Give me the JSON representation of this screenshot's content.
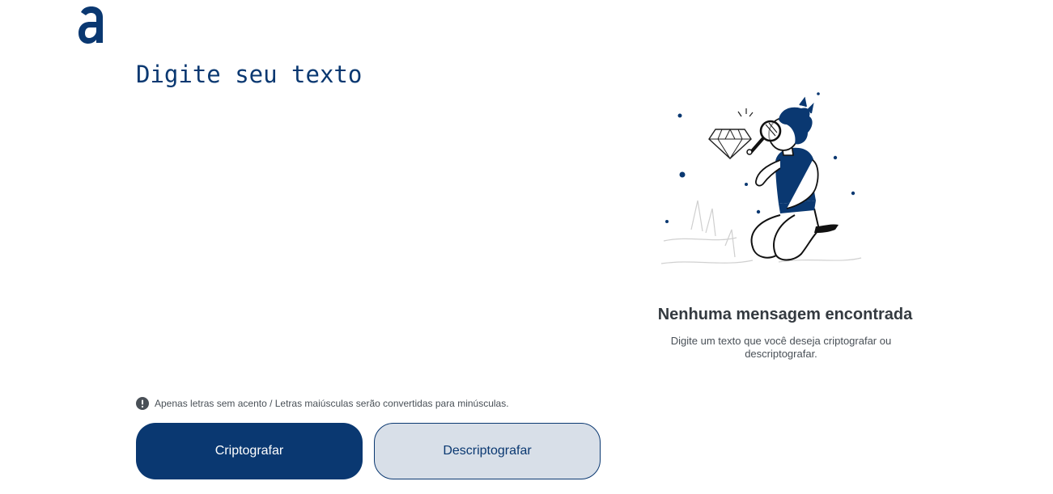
{
  "brand": {
    "logo_name": "alura-logo",
    "accent_color": "#0a3871"
  },
  "input": {
    "placeholder": "Digite seu texto",
    "value": ""
  },
  "hint": {
    "icon": "exclamation-circle-icon",
    "text": "Apenas letras sem acento / Letras maiúsculas serão convertidas para minúsculas."
  },
  "buttons": {
    "encrypt_label": "Criptografar",
    "decrypt_label": "Descriptografar"
  },
  "output": {
    "illustration": "person-with-magnifying-glass-illustration",
    "title": "Nenhuma mensagem encontrada",
    "description": "Digite um texto que você deseja criptografar ou descriptografar."
  }
}
